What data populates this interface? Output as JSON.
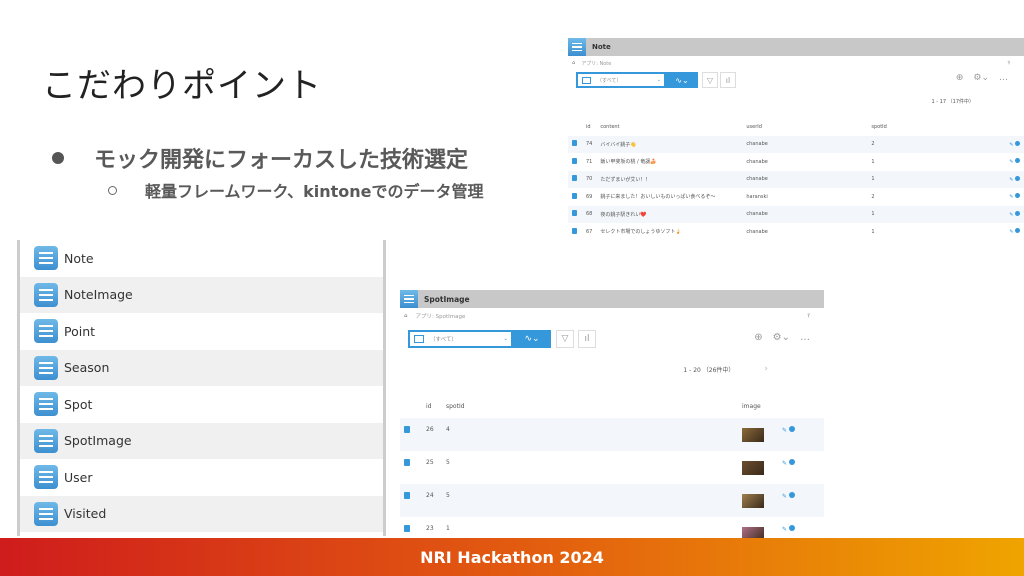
{
  "slide": {
    "title": "こだわりポイント",
    "bullet1": "モック開発にフォーカスした技術選定",
    "bullet2": "軽量フレームワーク、kintoneでのデータ管理",
    "footer": "NRI Hackathon 2024"
  },
  "app_list": [
    "Note",
    "NoteImage",
    "Point",
    "Season",
    "Spot",
    "SpotImage",
    "User",
    "Visited"
  ],
  "note_view": {
    "app_name": "Note",
    "breadcrumb": "アプリ: Note",
    "view_select": "（すべて）",
    "pagination": "1 - 17 （17件中）",
    "columns": [
      "id",
      "content",
      "userId",
      "spotId"
    ],
    "rows": [
      {
        "id": "74",
        "content": "バイバイ銚子👋",
        "userId": "chanabe",
        "spotId": "2"
      },
      {
        "id": "71",
        "content": "飯い甲斐坂の桃 / 竜譲🍰",
        "userId": "chanabe",
        "spotId": "1"
      },
      {
        "id": "70",
        "content": "ただずまいが艾い！！",
        "userId": "chanabe",
        "spotId": "1"
      },
      {
        "id": "69",
        "content": "銚子に来ました！おいしいものいっぱい食べるぞ〜",
        "userId": "haranski",
        "spotId": "2"
      },
      {
        "id": "68",
        "content": "夜の銚子駅きれい❤️",
        "userId": "chanabe",
        "spotId": "1"
      },
      {
        "id": "67",
        "content": "セレクト市場でのしょうゆソフト🍦",
        "userId": "chanabe",
        "spotId": "1"
      }
    ]
  },
  "spot_view": {
    "app_name": "SpotImage",
    "breadcrumb": "アプリ: SpotImage",
    "view_select": "（すべて）",
    "pagination": "1 - 20 （26件中）",
    "columns": [
      "id",
      "spotId",
      "image"
    ],
    "rows": [
      {
        "id": "26",
        "spotId": "4",
        "thumb": "#8a6a3a"
      },
      {
        "id": "25",
        "spotId": "5",
        "thumb": "#6b4e2e"
      },
      {
        "id": "24",
        "spotId": "5",
        "thumb": "#a08050"
      },
      {
        "id": "23",
        "spotId": "1",
        "thumb": "#b0708a"
      }
    ]
  },
  "icons": {
    "home": "home-icon",
    "pin": "pin-icon",
    "plus": "plus-icon",
    "gear": "gear-icon",
    "more": "more-icon",
    "filter": "filter-icon",
    "chart": "chart-icon",
    "edit": "pencil-icon",
    "record": "record-icon"
  },
  "colors": {
    "accent": "#3498db",
    "header_bg": "#c8c8c8",
    "footer_start": "#cf1c1c",
    "footer_end": "#efa400"
  }
}
